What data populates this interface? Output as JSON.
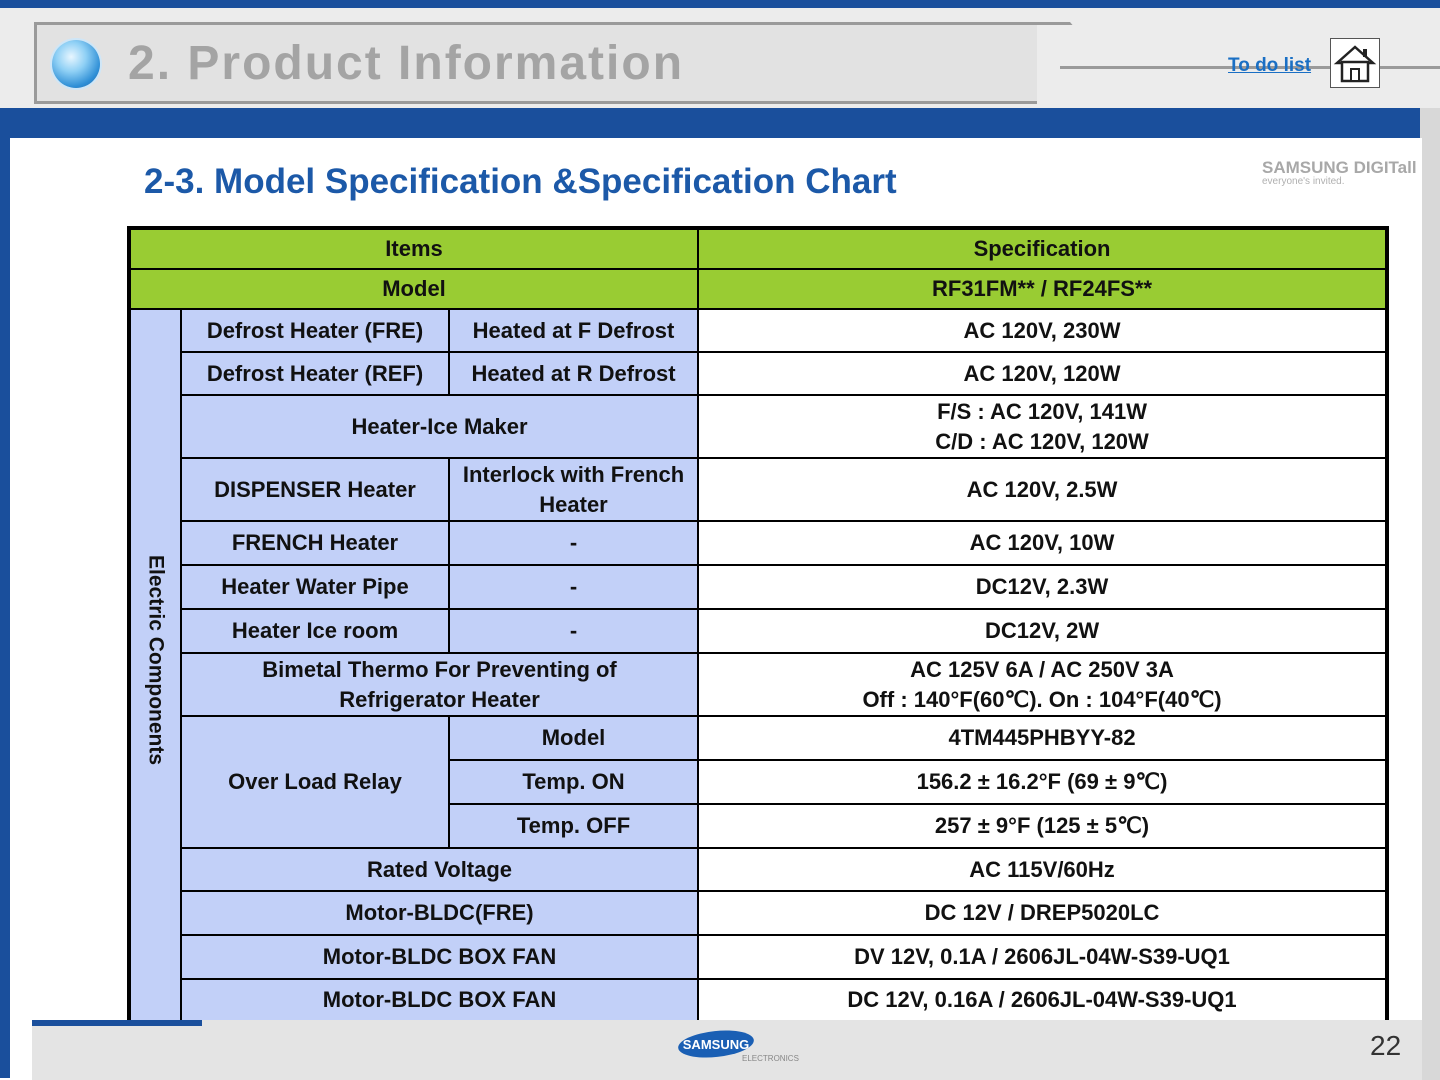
{
  "header": {
    "title": "2. Product Information",
    "todo_link": "To do list"
  },
  "section_title": "2-3. Model Specification &Specification Chart",
  "brand": {
    "main": "SAMSUNG DIGITall",
    "tagline": "everyone's invited."
  },
  "table": {
    "col_items": "Items",
    "col_spec": "Specification",
    "model_label": "Model",
    "model_value": "RF31FM** / RF24FS**",
    "group_label": "Electric Components",
    "rows": {
      "r1": {
        "item": "Defrost Heater (FRE)",
        "sub": "Heated at F Defrost",
        "spec": "AC 120V, 230W"
      },
      "r2": {
        "item": "Defrost Heater (REF)",
        "sub": "Heated at R Defrost",
        "spec": "AC 120V, 120W"
      },
      "r3": {
        "item": "Heater-Ice Maker",
        "spec_line1": "F/S : AC 120V, 141W",
        "spec_line2": "C/D : AC 120V, 120W"
      },
      "r4": {
        "item": "DISPENSER Heater",
        "sub_line1": "Interlock with French",
        "sub_line2": "Heater",
        "spec": "AC 120V, 2.5W"
      },
      "r5": {
        "item": "FRENCH Heater",
        "sub": "-",
        "spec": "AC 120V, 10W"
      },
      "r6": {
        "item": "Heater Water Pipe",
        "sub": "-",
        "spec": "DC12V, 2.3W"
      },
      "r7": {
        "item": "Heater Ice room",
        "sub": "-",
        "spec": "DC12V, 2W"
      },
      "r8": {
        "item_line1": "Bimetal Thermo For Preventing of",
        "item_line2": "Refrigerator Heater",
        "spec_line1": "AC 125V 6A / AC 250V 3A",
        "spec_line2": "Off : 140°F(60℃). On : 104°F(40℃)"
      },
      "r9": {
        "item": "Over Load Relay",
        "sub": "Model",
        "spec": "4TM445PHBYY-82"
      },
      "r10": {
        "sub": "Temp. ON",
        "spec": "156.2 ± 16.2°F (69 ± 9℃)"
      },
      "r11": {
        "sub": "Temp. OFF",
        "spec": "257 ± 9°F (125 ± 5℃)"
      },
      "r12": {
        "item": "Rated Voltage",
        "spec": "AC 115V/60Hz"
      },
      "r13": {
        "item": "Motor-BLDC(FRE)",
        "spec": "DC 12V / DREP5020LC"
      },
      "r14": {
        "item": "Motor-BLDC BOX FAN",
        "spec": "DV 12V, 0.1A / 2606JL-04W-S39-UQ1"
      },
      "r15": {
        "item": "Motor-BLDC BOX FAN",
        "spec": "DC 12V, 0.16A / 2606JL-04W-S39-UQ1"
      }
    }
  },
  "footer": {
    "logo_text": "SAMSUNG",
    "logo_sub": "ELECTRONICS",
    "page_number": "22"
  },
  "colors": {
    "header_green": "#99cc33",
    "row_lightblue": "#c2d0f8",
    "title_blue": "#1c59a8",
    "accent_blue": "#1a4f9c"
  }
}
